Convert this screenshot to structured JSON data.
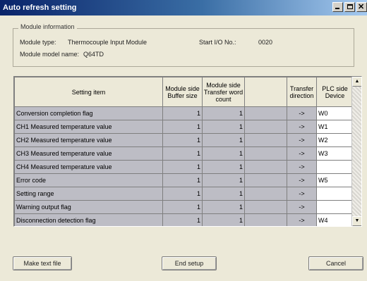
{
  "window": {
    "title": "Auto refresh setting"
  },
  "module_info": {
    "legend": "Module information",
    "type_label": "Module type:",
    "type_value": "Thermocouple Input Module",
    "start_io_label": "Start I/O No.:",
    "start_io_value": "0020",
    "model_label": "Module model name:",
    "model_value": "Q64TD"
  },
  "table": {
    "headers": {
      "item": "Setting item",
      "buffer": "Module side Buffer size",
      "count": "Module side Transfer word count",
      "blank": "",
      "direction": "Transfer direction",
      "device": "PLC side Device"
    },
    "rows": [
      {
        "item": "Conversion completion flag",
        "buffer": "1",
        "count": "1",
        "dir": "->",
        "device": "W0"
      },
      {
        "item": "CH1 Measured temperature value",
        "buffer": "1",
        "count": "1",
        "dir": "->",
        "device": "W1"
      },
      {
        "item": "CH2 Measured temperature value",
        "buffer": "1",
        "count": "1",
        "dir": "->",
        "device": "W2"
      },
      {
        "item": "CH3 Measured temperature value",
        "buffer": "1",
        "count": "1",
        "dir": "->",
        "device": "W3"
      },
      {
        "item": "CH4 Measured temperature value",
        "buffer": "1",
        "count": "1",
        "dir": "->",
        "device": ""
      },
      {
        "item": "Error code",
        "buffer": "1",
        "count": "1",
        "dir": "->",
        "device": "W5"
      },
      {
        "item": "Setting range",
        "buffer": "1",
        "count": "1",
        "dir": "->",
        "device": ""
      },
      {
        "item": "Warning output flag",
        "buffer": "1",
        "count": "1",
        "dir": "->",
        "device": ""
      },
      {
        "item": "Disconnection detection flag",
        "buffer": "1",
        "count": "1",
        "dir": "->",
        "device": "W4"
      }
    ]
  },
  "buttons": {
    "make_text": "Make text file",
    "end_setup": "End setup",
    "cancel": "Cancel"
  },
  "icons": {
    "minimize": "minimize-icon",
    "maximize": "maximize-icon",
    "close": "close-icon",
    "scroll_up": "scroll-up-arrow-icon",
    "scroll_down": "scroll-down-arrow-icon"
  },
  "colors": {
    "title_start": "#0a246a",
    "title_end": "#a6caf0",
    "row_gray": "#bdbdc5",
    "window_bg": "#ece9d8"
  }
}
